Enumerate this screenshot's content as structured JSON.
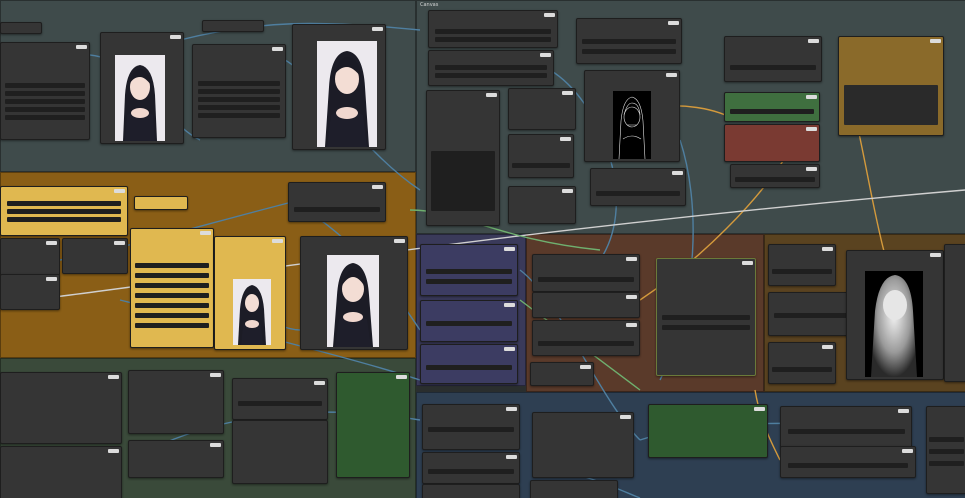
{
  "app": {
    "name": "",
    "canvas_bg": "#2a2e2e"
  },
  "groups": [
    {
      "id": "g-top-left",
      "title": "",
      "color": "#3f4b4b"
    },
    {
      "id": "g-top-right",
      "title": "Canvas",
      "color": "#3f4b4b"
    },
    {
      "id": "g-orange",
      "title": "",
      "color": "#8a5e16"
    },
    {
      "id": "g-purple",
      "title": "",
      "color": "#3a3a5a"
    },
    {
      "id": "g-brown",
      "title": "",
      "color": "#5a3a2a"
    },
    {
      "id": "g-darkorange",
      "title": "",
      "color": "#5a4320"
    },
    {
      "id": "g-green-bottom",
      "title": "",
      "color": "#3a4a3a"
    },
    {
      "id": "g-blue-bottom",
      "title": "",
      "color": "#2e3f52"
    }
  ],
  "icons": {
    "portrait": "portrait-image-icon",
    "lineart": "lineart-image-icon",
    "depth": "depth-map-image-icon"
  },
  "colors": {
    "wire_blue": "#4f7fa0",
    "wire_orange": "#d49a3c",
    "wire_green": "#6fb06f",
    "wire_white": "#d0d0d0",
    "node_green": "#3f6f3f",
    "node_red": "#7a3a32",
    "note_yellow": "#e0b850"
  }
}
